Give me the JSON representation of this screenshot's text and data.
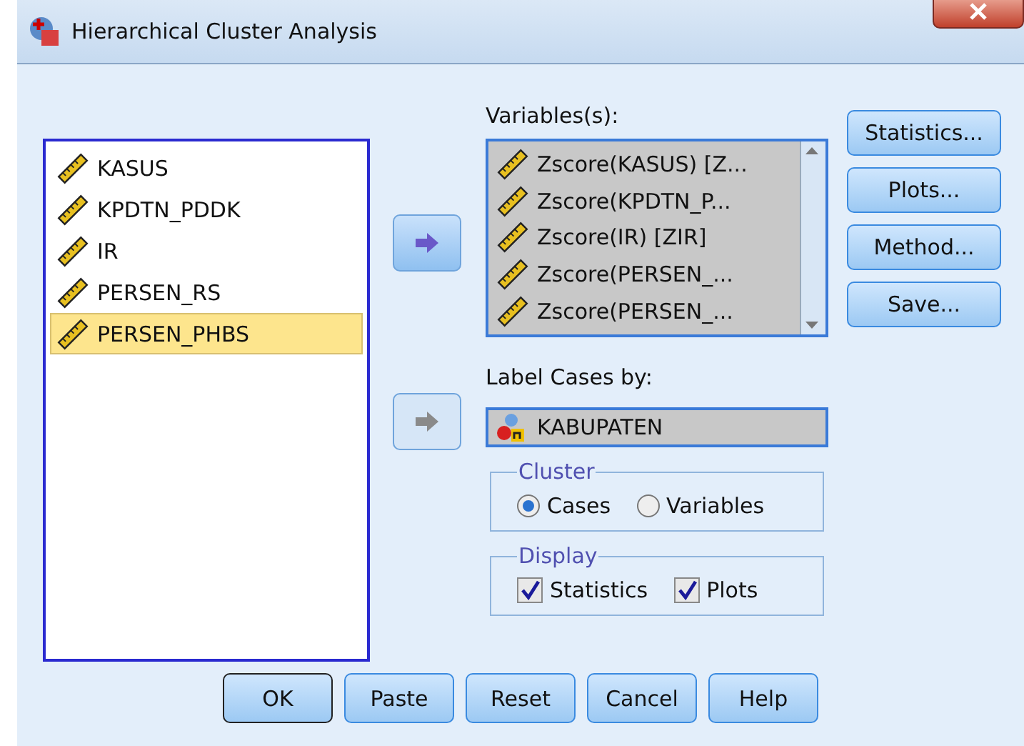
{
  "window": {
    "title": "Hierarchical Cluster Analysis"
  },
  "source_list": {
    "items": [
      {
        "label": "KASUS",
        "selected": false
      },
      {
        "label": "KPDTN_PDDK",
        "selected": false
      },
      {
        "label": "IR",
        "selected": false
      },
      {
        "label": "PERSEN_RS",
        "selected": false
      },
      {
        "label": "PERSEN_PHBS",
        "selected": true
      }
    ]
  },
  "transfer_buttons": [
    {
      "disabled": false
    },
    {
      "disabled": true
    }
  ],
  "variables": {
    "label": "Variables(s):",
    "items": [
      {
        "label": "Zscore(KASUS) [Z..."
      },
      {
        "label": "Zscore(KPDTN_P..."
      },
      {
        "label": "Zscore(IR) [ZIR]"
      },
      {
        "label": "Zscore(PERSEN_..."
      },
      {
        "label": "Zscore(PERSEN_..."
      }
    ]
  },
  "label_cases": {
    "label": "Label Cases by:",
    "value": "KABUPATEN"
  },
  "cluster": {
    "title": "Cluster",
    "options": [
      {
        "label": "Cases",
        "selected": true
      },
      {
        "label": "Variables",
        "selected": false
      }
    ]
  },
  "display": {
    "title": "Display",
    "options": [
      {
        "label": "Statistics",
        "checked": true
      },
      {
        "label": "Plots",
        "checked": true
      }
    ]
  },
  "side_buttons": [
    "Statistics...",
    "Plots...",
    "Method...",
    "Save..."
  ],
  "buttons": [
    {
      "label": "OK",
      "default": true
    },
    {
      "label": "Paste",
      "default": false
    },
    {
      "label": "Reset",
      "default": false
    },
    {
      "label": "Cancel",
      "default": false
    },
    {
      "label": "Help",
      "default": false
    }
  ]
}
